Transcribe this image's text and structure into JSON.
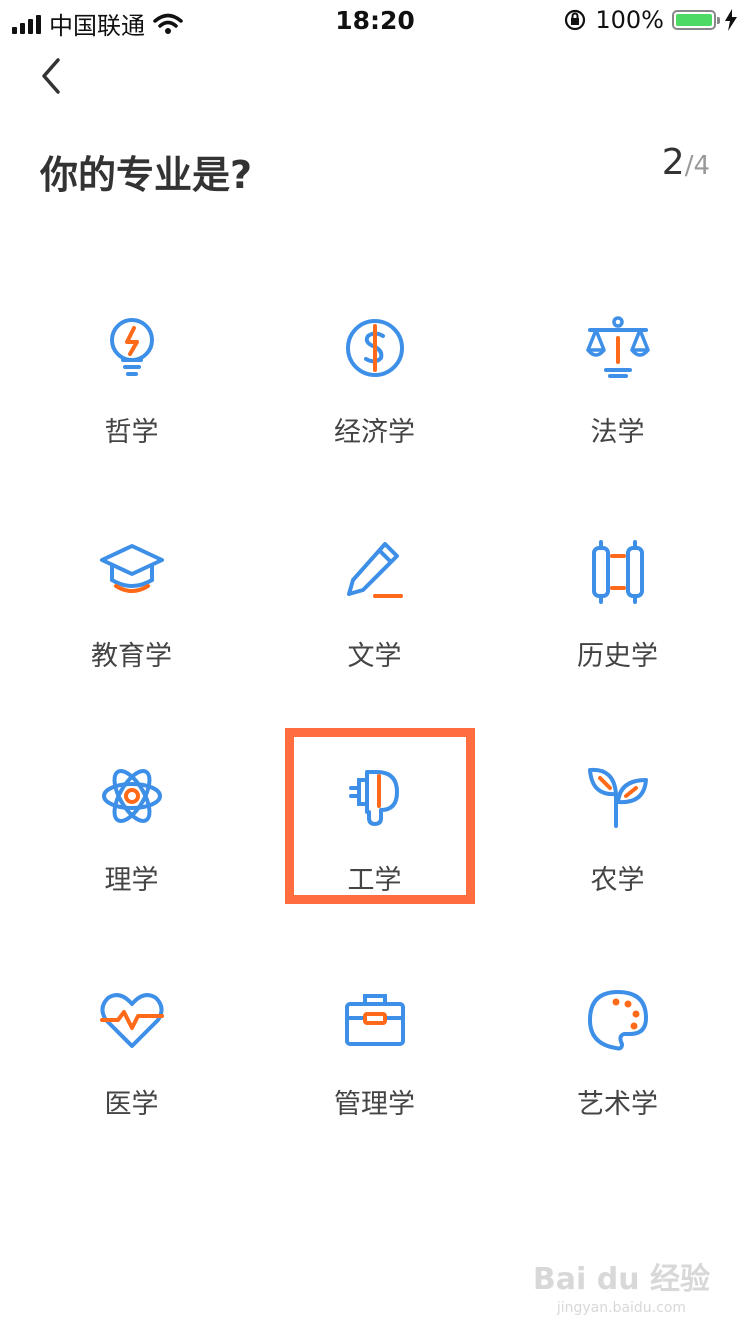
{
  "status_bar": {
    "carrier": "中国联通",
    "time": "18:20",
    "battery_percent": "100%"
  },
  "header": {
    "title": "你的专业是?",
    "step_current": "2",
    "step_separator": "/",
    "step_total": "4"
  },
  "majors": [
    {
      "label": "哲学",
      "icon": "lightbulb-icon"
    },
    {
      "label": "经济学",
      "icon": "dollar-coin-icon"
    },
    {
      "label": "法学",
      "icon": "scales-icon"
    },
    {
      "label": "教育学",
      "icon": "graduation-cap-icon"
    },
    {
      "label": "文学",
      "icon": "pencil-icon"
    },
    {
      "label": "历史学",
      "icon": "scroll-icon"
    },
    {
      "label": "理学",
      "icon": "atom-icon"
    },
    {
      "label": "工学",
      "icon": "plug-icon"
    },
    {
      "label": "农学",
      "icon": "sprout-icon"
    },
    {
      "label": "医学",
      "icon": "heartbeat-icon"
    },
    {
      "label": "管理学",
      "icon": "briefcase-icon"
    },
    {
      "label": "艺术学",
      "icon": "palette-icon"
    }
  ],
  "highlighted_major": "工学",
  "watermark": {
    "main": "Bai du 经验",
    "sub": "jingyan.baidu.com"
  },
  "colors": {
    "icon_blue": "#3d8fe8",
    "icon_orange": "#ff6a1a",
    "highlight": "#ff6c40",
    "battery_green": "#4cd964"
  }
}
